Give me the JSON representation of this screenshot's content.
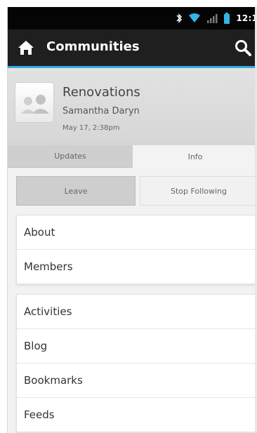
{
  "status": {
    "time": "12:1",
    "icons": [
      "bluetooth-icon",
      "wifi-icon",
      "signal-icon",
      "battery-icon"
    ]
  },
  "actionbar": {
    "title": "Communities",
    "accent_color": "#33a9e0"
  },
  "community": {
    "name": "Renovations",
    "owner": "Samantha Daryn",
    "date": "May 17, 2:38pm"
  },
  "tabs": [
    {
      "label": "Updates",
      "active": false
    },
    {
      "label": "Info",
      "active": true
    }
  ],
  "buttons": {
    "leave": "Leave",
    "stop_following": "Stop Following"
  },
  "list1": [
    {
      "label": "About"
    },
    {
      "label": "Members"
    }
  ],
  "list2": [
    {
      "label": "Activities"
    },
    {
      "label": "Blog"
    },
    {
      "label": "Bookmarks"
    },
    {
      "label": "Feeds"
    }
  ]
}
